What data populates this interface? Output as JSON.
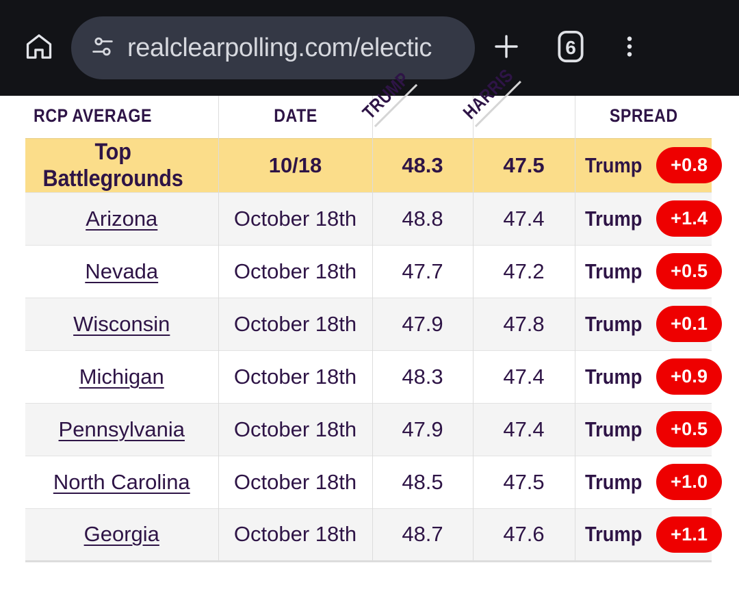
{
  "browser": {
    "home_icon": "home-icon",
    "site_settings_icon": "tune-sliders-icon",
    "url_text": "realclearpolling.com/electic",
    "new_tab_icon": "plus-icon",
    "tab_count": "6",
    "menu_icon": "three-dot-menu-icon"
  },
  "table": {
    "headers": {
      "rcp_average": "RCP AVERAGE",
      "date": "DATE",
      "trump": "TRUMP",
      "harris": "HARRIS",
      "spread": "SPREAD"
    },
    "colors": {
      "highlight_row": "#fbdd8a",
      "alt_row": "#f4f4f4",
      "text": "#2e1446",
      "badge_red": "#ee0000"
    },
    "rows": [
      {
        "name": "Top Battlegrounds",
        "date": "10/18",
        "trump": "48.3",
        "harris": "47.5",
        "spread_leader": "Trump",
        "spread_value": "+0.8"
      },
      {
        "name": "Arizona",
        "date": "October 18th",
        "trump": "48.8",
        "harris": "47.4",
        "spread_leader": "Trump",
        "spread_value": "+1.4"
      },
      {
        "name": "Nevada",
        "date": "October 18th",
        "trump": "47.7",
        "harris": "47.2",
        "spread_leader": "Trump",
        "spread_value": "+0.5"
      },
      {
        "name": "Wisconsin",
        "date": "October 18th",
        "trump": "47.9",
        "harris": "47.8",
        "spread_leader": "Trump",
        "spread_value": "+0.1"
      },
      {
        "name": "Michigan",
        "date": "October 18th",
        "trump": "48.3",
        "harris": "47.4",
        "spread_leader": "Trump",
        "spread_value": "+0.9"
      },
      {
        "name": "Pennsylvania",
        "date": "October 18th",
        "trump": "47.9",
        "harris": "47.4",
        "spread_leader": "Trump",
        "spread_value": "+0.5"
      },
      {
        "name": "North Carolina",
        "date": "October 18th",
        "trump": "48.5",
        "harris": "47.5",
        "spread_leader": "Trump",
        "spread_value": "+1.0"
      },
      {
        "name": "Georgia",
        "date": "October 18th",
        "trump": "48.7",
        "harris": "47.6",
        "spread_leader": "Trump",
        "spread_value": "+1.1"
      }
    ]
  }
}
